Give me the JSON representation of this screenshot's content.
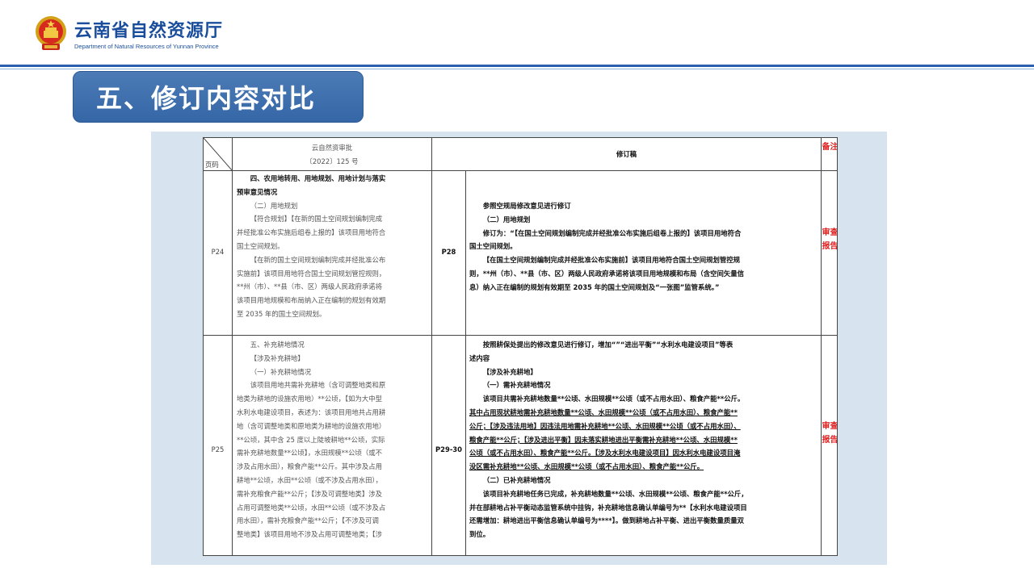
{
  "header": {
    "org_name": "云南省自然资源厅",
    "org_name_en": "Department of Natural Resources of Yunnan Province"
  },
  "colors": {
    "brand_blue": "#1a4e9c",
    "title_bg": "#3d6eaf",
    "panel_bg": "#d7e4ef",
    "remark_red": "#e02020"
  },
  "section": {
    "title": "五、修订内容对比"
  },
  "table": {
    "header": {
      "page_label": "页码",
      "original_title_1": "云自然资审批",
      "original_title_2": "〔2022〕125 号",
      "revised_title": "修订稿",
      "remark_title": "备注"
    },
    "rows": [
      {
        "page_original": "P24",
        "page_revised": "P28",
        "remark": "审查报告",
        "original_lines": [
          "四、农用地转用、用地规划、用地计划与落实",
          "预审意见情况",
          "（二）用地规划",
          "【符合规划】【在新的国土空间规划编制完成",
          "并经批准公布实施后组卷上报的】该项目用地符合",
          "国土空间规划。",
          "【在新的国土空间规划编制完成并经批准公布",
          "实施前】该项目用地符合国土空间规划管控规则，",
          "**州（市）、**县（市、区）两级人民政府承诺将",
          "该项目用地规模和布局纳入正在编制的规划有效期",
          "至 2035 年的国土空间规划。"
        ],
        "revised_lines": [
          "参照空规局修改意见进行修订",
          "（二）用地规划",
          "修订为：“【在国土空间规划编制完成并经批准公布实施后组卷上报的】该项目用地符合",
          "国土空间规划。",
          "【在国土空间规划编制完成并经批准公布实施前】该项目用地符合国土空间规划管控规",
          "则，**州（市）、**县（市、区）两级人民政府承诺将该项目用地规模和布局（含空间矢量信",
          "息）纳入正在编制的规划有效期至 2035 年的国土空间规划及“一张图”监管系统。”"
        ]
      },
      {
        "page_original": "P25",
        "page_revised": "P29-30",
        "remark": "审查报告",
        "original_lines": [
          "五、补充耕地情况",
          "【涉及补充耕地】",
          "（一）补充耕地情况",
          "该项目用地共需补充耕地（含可调整地类和原",
          "地类为耕地的设施农用地）**公顷，【如为大中型",
          "水利水电建设项目，表述为：该项目用地共占用耕",
          "地（含可调整地类和原地类为耕地的设施农用地）",
          "**公顷，其中含 25 度以上陡坡耕地**公顷，实际",
          "需补充耕地数量**公顷】，水田规模**公顷（或不",
          "涉及占用水田），粮食产能**公斤。其中涉及占用",
          "耕地**公顷，水田**公顷（或不涉及占用水田），",
          "需补充粮食产能**公斤；【涉及可调整地类】涉及",
          "占用可调整地类**公顷，水田**公顷（或不涉及占",
          "用水田），需补充粮食产能**公斤；【不涉及可调",
          "整地类】该项目用地不涉及占用可调整地类；【涉"
        ],
        "revised_lines": [
          "按照耕保处提出的修改意见进行修订，增加“”“进出平衡”“水利水电建设项目”等表",
          "述内容",
          "【涉及补充耕地】",
          "（一）需补充耕地情况",
          "该项目共需补充耕地数量**公顷、水田规模**公顷（或不占用水田）、粮食产能**公斤。",
          "其中占用现状耕地需补充耕地数量**公顷、水田规模**公顷（或不占用水田）、粮食产能**",
          "公斤；【涉及违法用地】因违法用地需补充耕地**公顷、水田规模**公顷（或不占用水田）、",
          "粮食产能**公斤；【涉及进出平衡】因未落实耕地进出平衡需补充耕地**公顷、水田规模**",
          "公顷（或不占用水田）、粮食产能**公斤。【涉及水利水电建设项目】因水利水电建设项目淹",
          "没区需补充耕地**公顷、水田规模**公顷（或不占用水田）、粮食产能**公斤。",
          "（二）已补充耕地情况",
          "该项目补充耕地任务已完成，补充耕地数量**公顷、水田规模**公顷、粮食产能**公斤，",
          "并在部耕地占补平衡动态监管系统中挂钩，补充耕地信息确认单编号为**【水利水电建设项目",
          "还需增加：耕地进出平衡信息确认单编号为****】。做到耕地占补平衡、进出平衡数量质量双",
          "到位。"
        ]
      }
    ]
  }
}
